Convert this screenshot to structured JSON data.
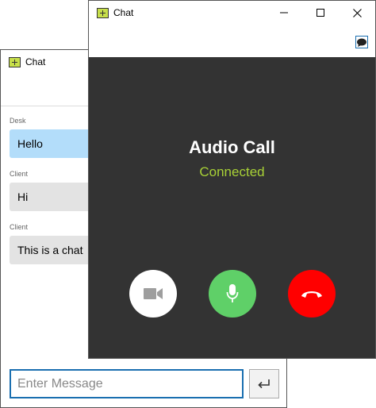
{
  "back_window": {
    "title": "Chat",
    "messages": [
      {
        "sender": "Desk",
        "text": "Hello",
        "type": "desk"
      },
      {
        "sender": "Client",
        "text": "Hi",
        "type": "client"
      },
      {
        "sender": "Client",
        "text": "This is a chat",
        "type": "client"
      }
    ],
    "input": {
      "placeholder": "Enter Message",
      "value": ""
    },
    "send_icon": "enter-arrow-icon"
  },
  "call_window": {
    "title": "Chat",
    "call_title": "Audio Call",
    "status": "Connected",
    "buttons": {
      "video_icon": "video-camera-icon",
      "mic_icon": "microphone-icon",
      "hangup_icon": "phone-hangup-icon"
    }
  },
  "colors": {
    "call_bg": "#333333",
    "status_green": "#a8d136",
    "desk_bubble": "#b3ddfa",
    "client_bubble": "#e3e3e3",
    "mic_green": "#5fd068",
    "hangup_red": "#ff0000",
    "input_border": "#1a6fb0"
  }
}
